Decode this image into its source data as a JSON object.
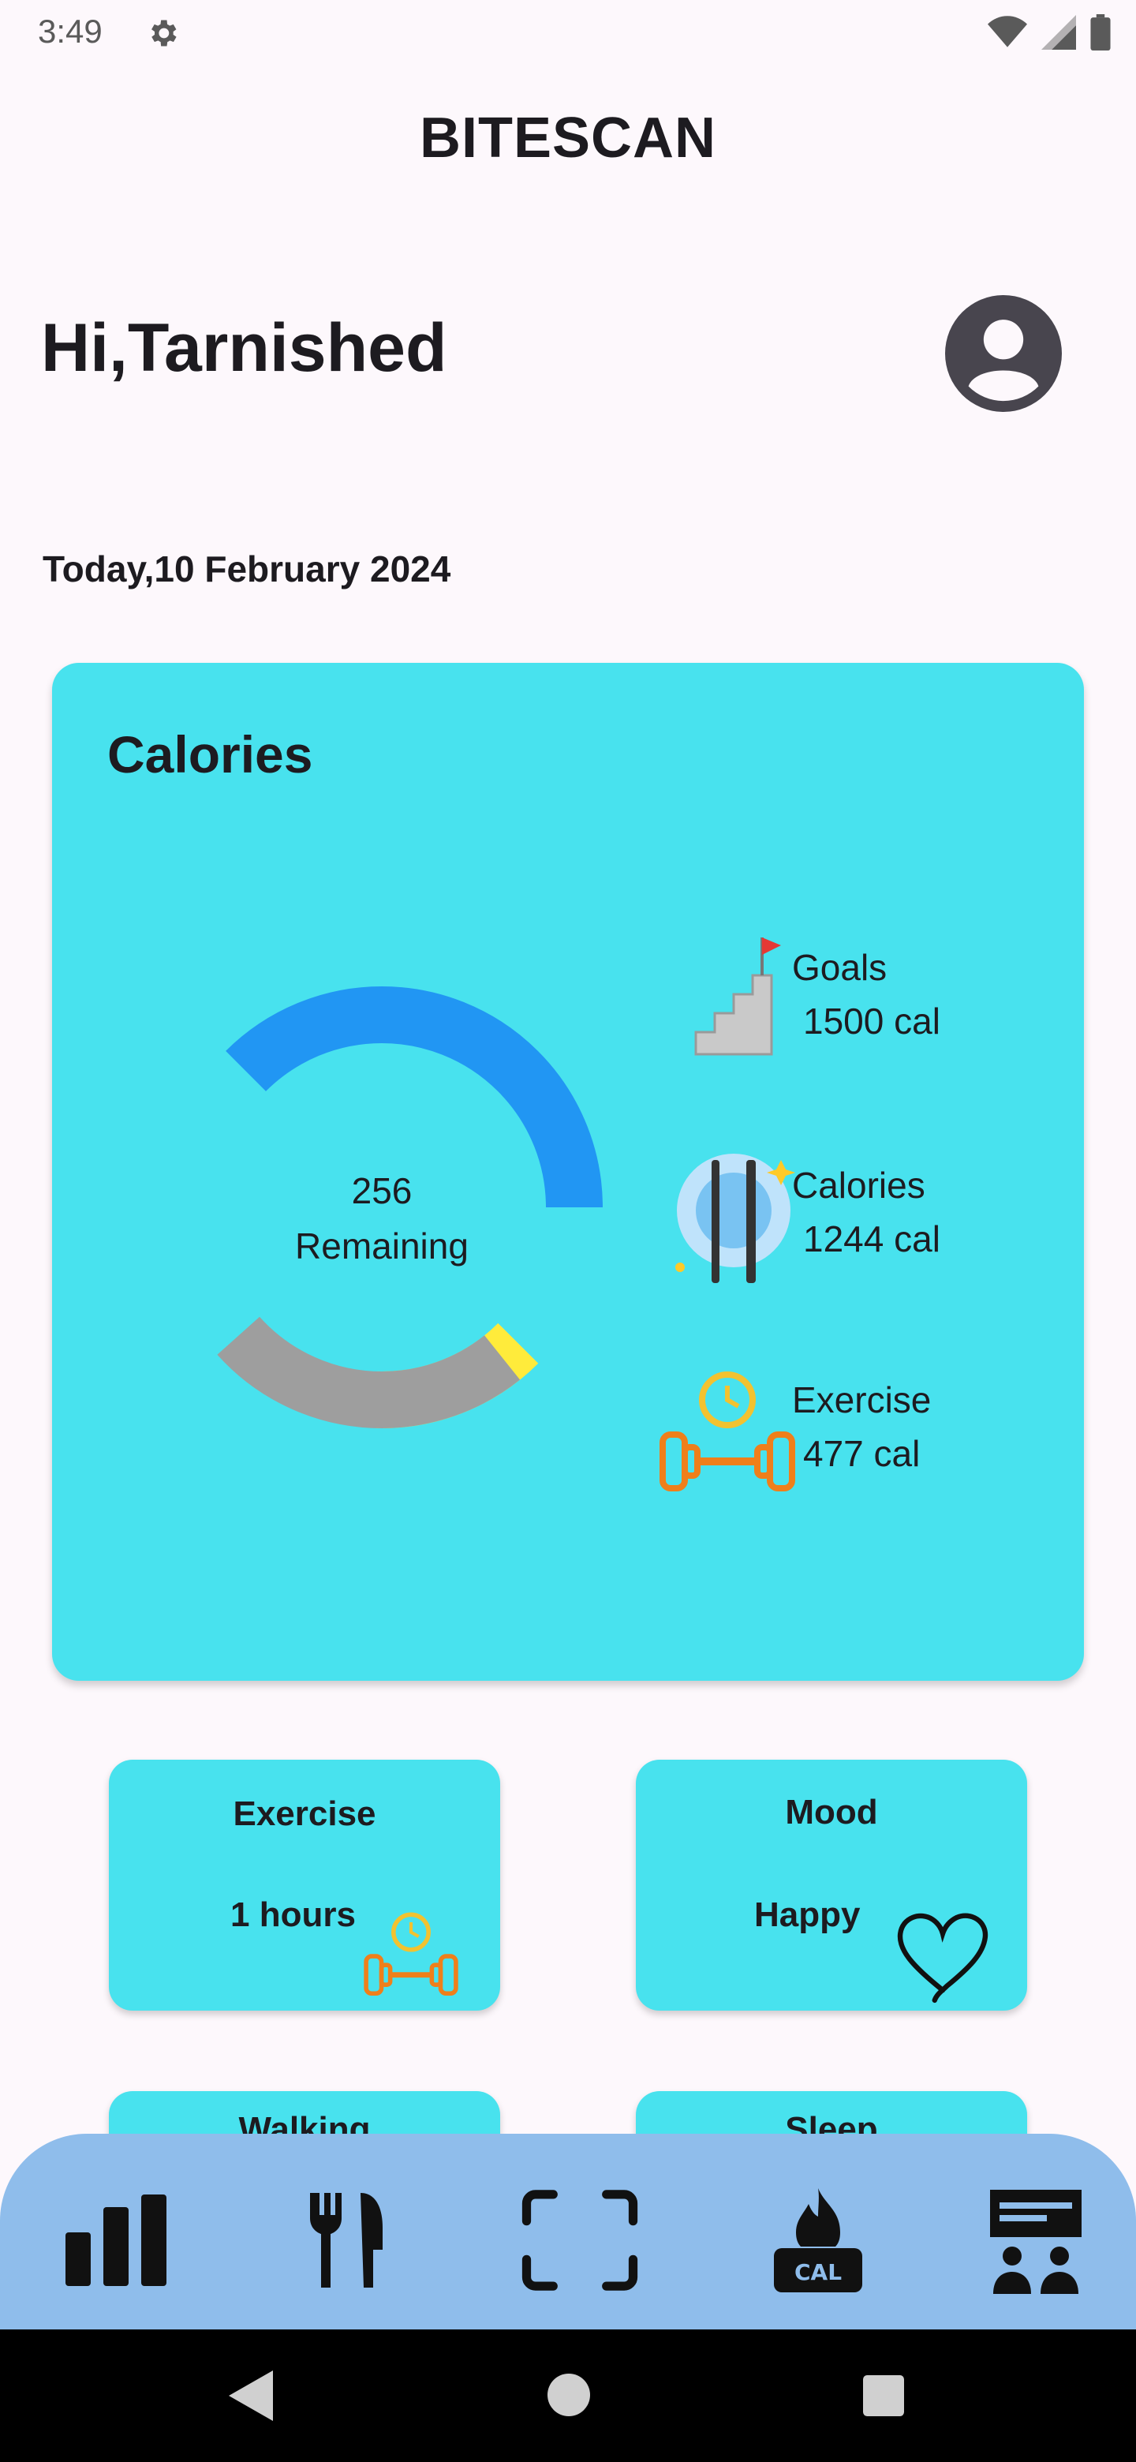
{
  "status_bar": {
    "time": "3:49",
    "icons": [
      "settings-gear-icon",
      "wifi-icon",
      "signal-icon",
      "battery-icon"
    ]
  },
  "app": {
    "title": "BITESCAN",
    "greeting": "Hi,Tarnished",
    "date": "Today,10 February 2024"
  },
  "calories_card": {
    "title": "Calories",
    "remaining_value": "256",
    "remaining_label": "Remaining",
    "legend": [
      {
        "label": "Goals",
        "value": "1500 cal",
        "icon": "goal-stairs-flag-icon"
      },
      {
        "label": "Calories",
        "value": "1244 cal",
        "icon": "plate-fork-knife-icon"
      },
      {
        "label": "Exercise",
        "value": "477 cal",
        "icon": "dumbbell-clock-icon"
      }
    ],
    "chart_data": {
      "type": "pie",
      "variant": "donut",
      "center_text": [
        "256",
        "Remaining"
      ],
      "segments": [
        {
          "value": 1244,
          "color": "#2196f3"
        },
        {
          "value": 256,
          "color": "#ffeb3b"
        },
        {
          "value": 477,
          "color": "#9e9e9e"
        }
      ]
    }
  },
  "tiles": {
    "exercise": {
      "title": "Exercise",
      "value": "1 hours",
      "icon": "dumbbell-clock-icon"
    },
    "mood": {
      "title": "Mood",
      "value": "Happy",
      "icon": "heart-icon"
    },
    "walking": {
      "title": "Walking"
    },
    "sleep": {
      "title": "Sleep"
    }
  },
  "bottom_nav": {
    "items": [
      {
        "icon": "bar-chart-icon"
      },
      {
        "icon": "fork-knife-icon"
      },
      {
        "icon": "scan-frame-icon"
      },
      {
        "icon": "cal-flame-icon"
      },
      {
        "icon": "community-board-icon"
      }
    ]
  },
  "colors": {
    "card": "#48e2ee",
    "nav": "#8fbdeb",
    "background": "#fdf8fc"
  }
}
